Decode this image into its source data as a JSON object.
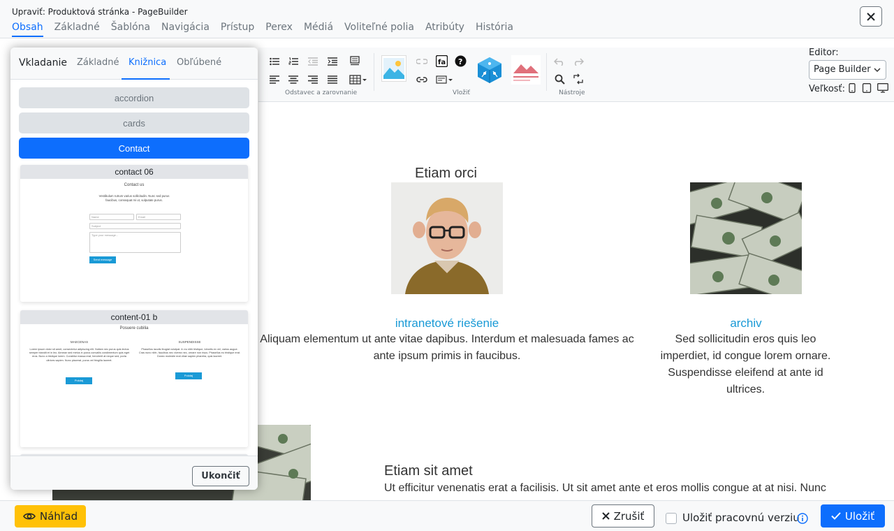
{
  "header": {
    "title": "Upraviť: Produktová stránka - PageBuilder",
    "tabs": [
      {
        "label": "Obsah"
      },
      {
        "label": "Základné"
      },
      {
        "label": "Šablóna"
      },
      {
        "label": "Navigácia"
      },
      {
        "label": "Prístup"
      },
      {
        "label": "Perex"
      },
      {
        "label": "Médiá"
      },
      {
        "label": "Voliteľné polia"
      },
      {
        "label": "Atribúty"
      },
      {
        "label": "História"
      }
    ],
    "close_icon": "close-icon"
  },
  "toolbar": {
    "groups": [
      {
        "label": "Odstavec a zarovnanie"
      },
      {
        "label": "Vložiť"
      },
      {
        "label": "Nástroje"
      }
    ],
    "editor_label": "Editor:",
    "editor_value": "Page Builder",
    "size_label": "Veľkosť:"
  },
  "panel": {
    "tabs": [
      {
        "label": "Vkladanie"
      },
      {
        "label": "Základné"
      },
      {
        "label": "Knižnica"
      },
      {
        "label": "Obľúbené"
      }
    ],
    "categories": [
      {
        "label": "accordion"
      },
      {
        "label": "cards"
      },
      {
        "label": "Contact"
      }
    ],
    "templates": [
      {
        "title": "contact 06",
        "heading": "Contact us",
        "text": "Vestibulum rutrum varius sollicitudin. Nunc sed purus faucibus, consequat mi ut, vulputate purus.",
        "name_placeholder": "Name",
        "email_placeholder": "Email",
        "subject_placeholder": "Subject",
        "message_placeholder": "Type your message...",
        "button": "Send message"
      },
      {
        "title": "content-01 b",
        "heading": "Posuere cubilia",
        "col1_title": "MAECENAS",
        "col1_text": "Lorem ipsum dolor sit amet, consectetur adipiscing elit. Nullam nec purus quis lectus semper blandit et in leo. Aenean sed metus in purus convallis condimentum quis eget eros. Nunc a tristique lorem. Curabitur massa erat, hendrerit at neque sed, porta ultrices sapien. Nunc placerat, purus vel fringilla laoreet.",
        "col1_button": "Pokdaj",
        "col2_title": "SUSPENDISSE",
        "col2_text": "Phasellus iaculis feugiat volutpat. In eu nibh tristique, lobortis ex vel, varius augue. Cras nunc nibh, faucibus nec viverra nec, ornare non risus. Phasellus eu tristique erat. Donec molestie erat vitae sapien pharetra, quis laoreet.",
        "col2_button": "Pokdaj"
      }
    ],
    "finish_label": "Ukončiť"
  },
  "canvas": {
    "col1_heading": "Etiam orci",
    "col1_link": "intranetové riešenie",
    "col1_text": "Aliquam elementum ut ante vitae dapibus. Interdum et malesuada fames ac ante ipsum primis in faucibus.",
    "col2_link": "archiv",
    "col2_text": "Sed sollicitudin eros quis leo imperdiet, id congue lorem ornare. Suspendisse eleifend at ante id ultrices.",
    "section2_heading": "Etiam sit amet",
    "section2_text": "Ut efficitur venenatis erat a facilisis. Ut sit amet ante et eros mollis congue at at nisi. Nunc"
  },
  "footer": {
    "preview_label": "Náhľad",
    "cancel_label": "Zrušiť",
    "draft_label": "Uložiť pracovnú verziu",
    "save_label": "Uložiť"
  },
  "colors": {
    "accent": "#0d6efd",
    "preview": "#ffc107",
    "link": "#1a9ad6"
  }
}
